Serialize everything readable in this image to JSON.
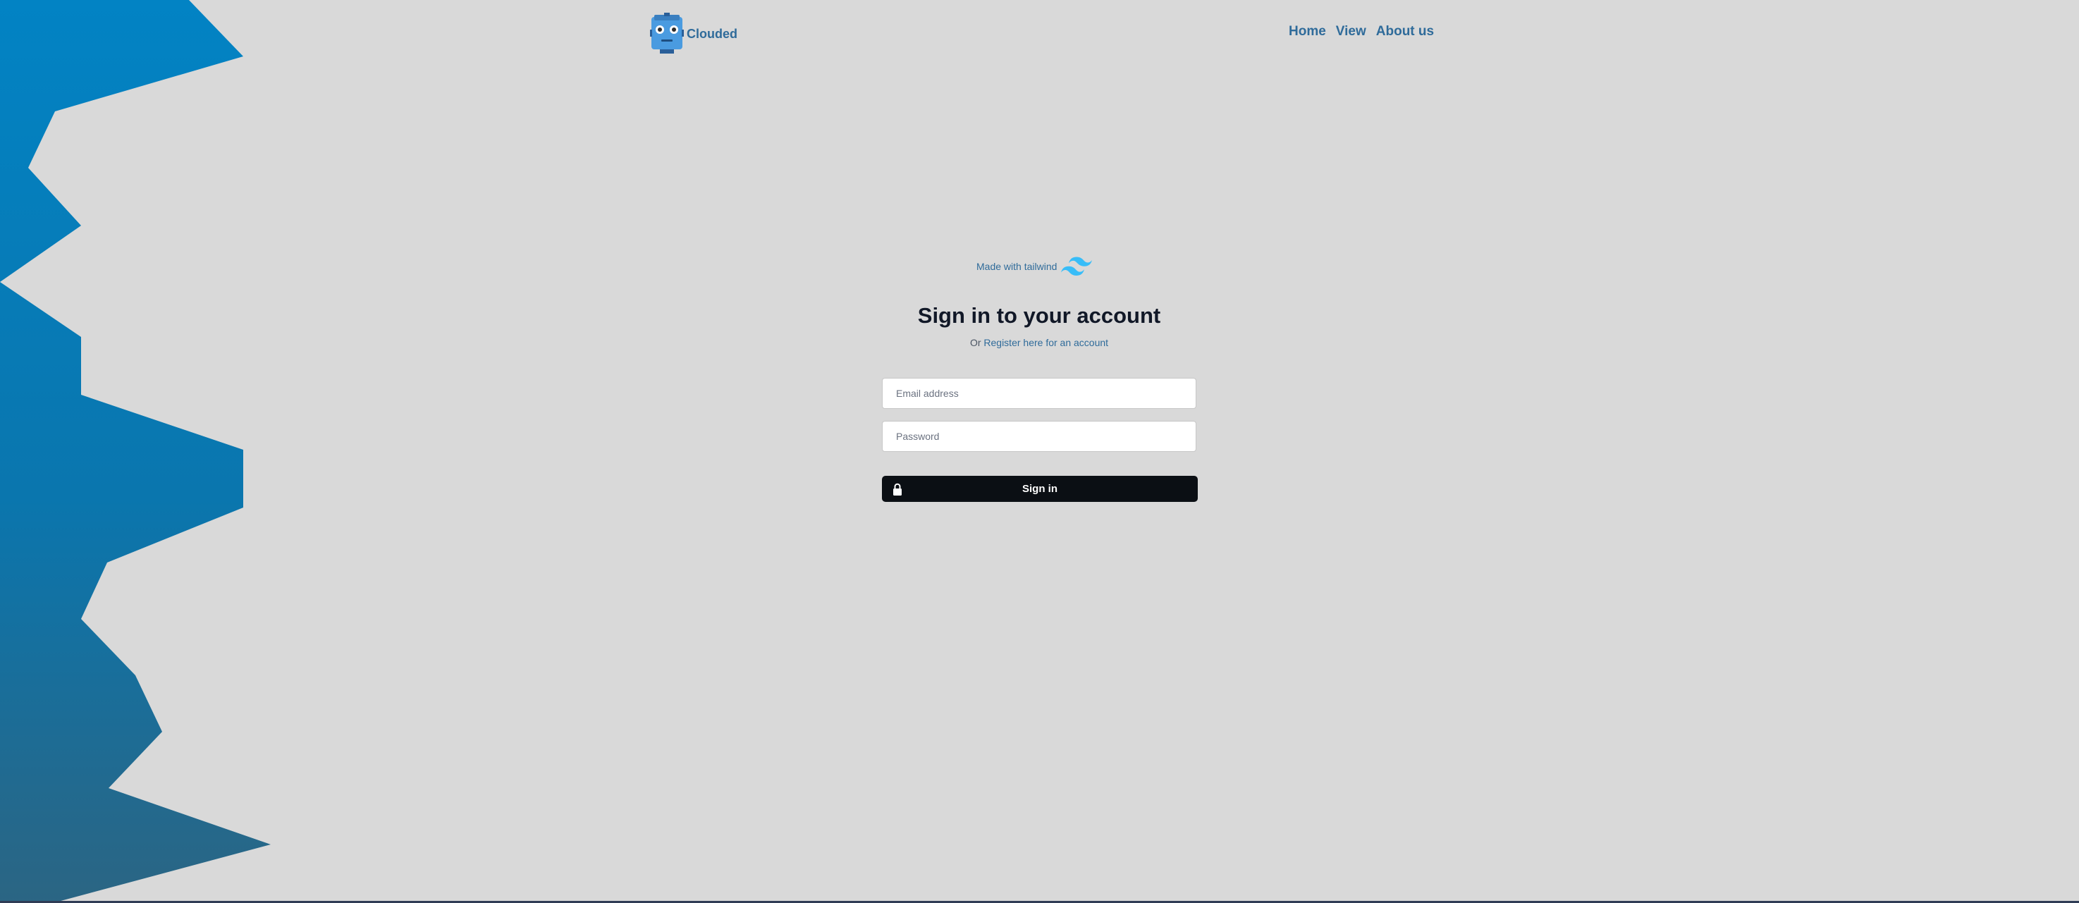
{
  "brand": {
    "name": "Clouded"
  },
  "nav": {
    "items": [
      "Home",
      "View",
      "About us"
    ]
  },
  "form": {
    "made_with": "Made with tailwind",
    "title": "Sign in to your account",
    "subtitle_prefix": "Or ",
    "register_link": "Register here for an account",
    "email_placeholder": "Email address",
    "password_placeholder": "Password",
    "signin_label": "Sign in"
  },
  "colors": {
    "background": "#d9d9d9",
    "accent": "#2f6b9a",
    "button": "#0b0f14",
    "shape_top": "#0283c4",
    "shape_bottom": "#2b6583"
  }
}
